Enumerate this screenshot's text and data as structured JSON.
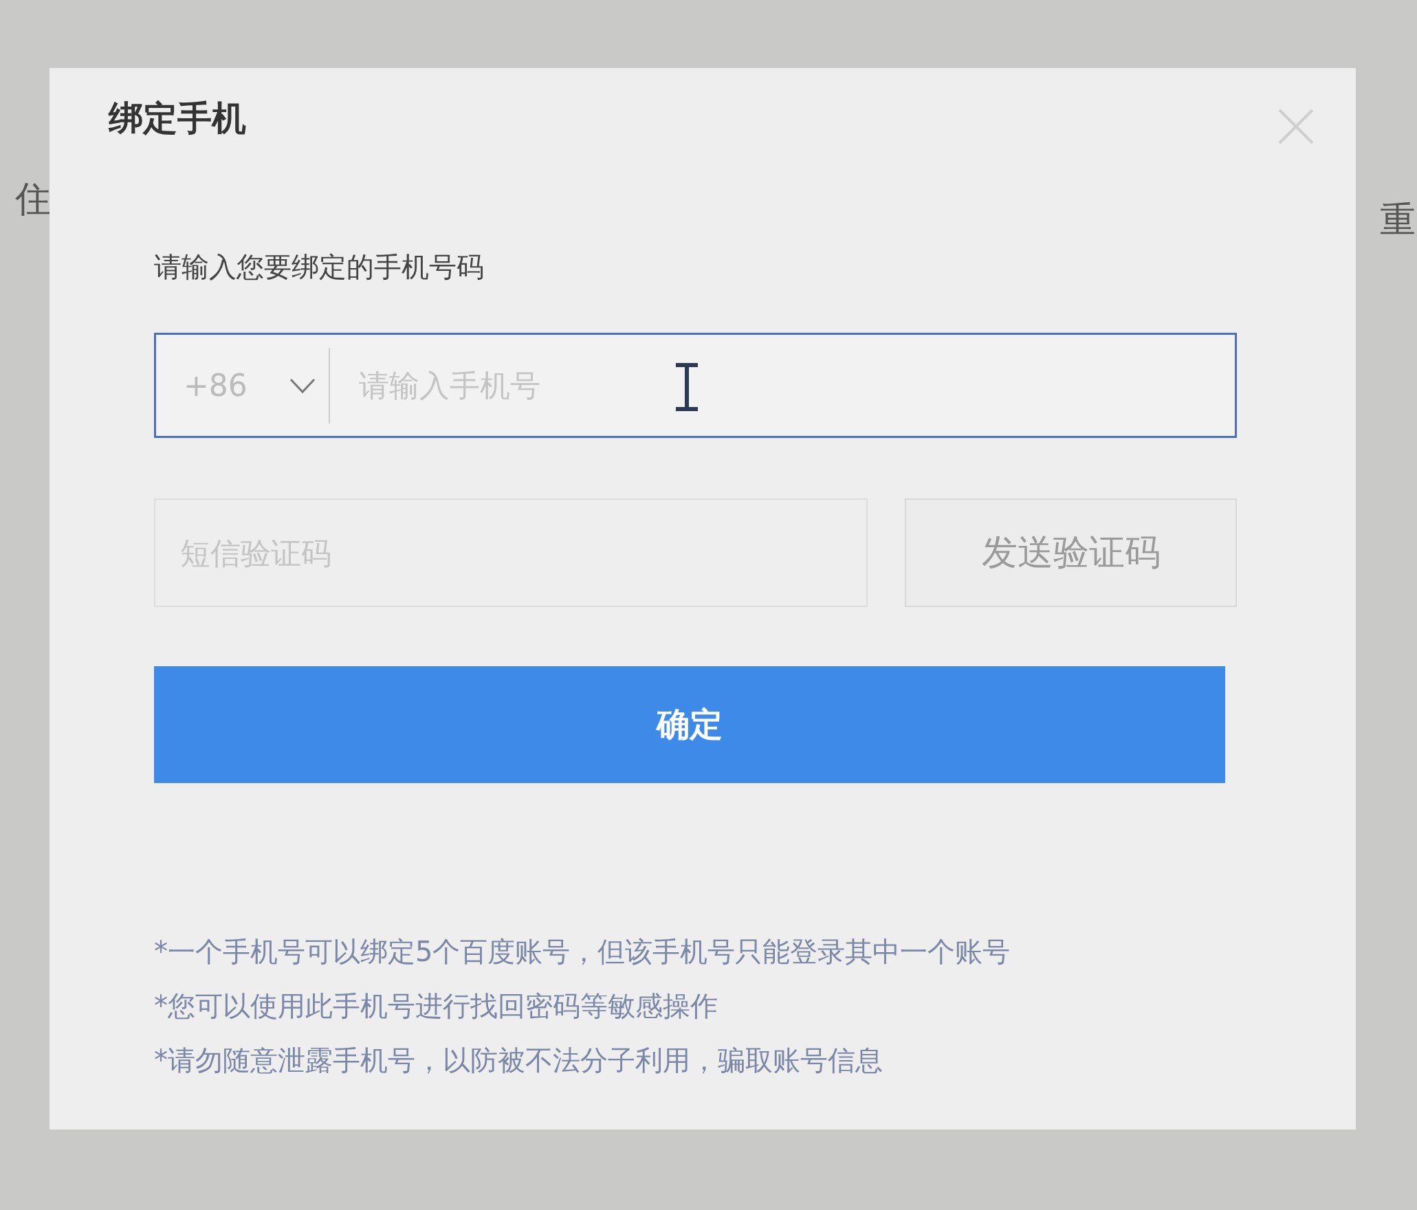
{
  "background_text": [
    "住",
    "重"
  ],
  "dialog": {
    "title": "绑定手机",
    "prompt": "请输入您要绑定的手机号码",
    "country_code": "+86",
    "phone_field": {
      "placeholder": "请输入手机号",
      "focused": true
    },
    "code_field": {
      "placeholder": "短信验证码"
    },
    "send_code_button": {
      "label": "发送验证码",
      "disabled": true
    },
    "confirm_button": {
      "label": "确定"
    },
    "notes": [
      "*一个手机号可以绑定5个百度账号，但该手机号只能登录其中一个账号",
      "*您可以使用此手机号进行找回密码等敏感操作",
      "*请勿随意泄露手机号，以防被不法分子利用，骗取账号信息"
    ]
  }
}
